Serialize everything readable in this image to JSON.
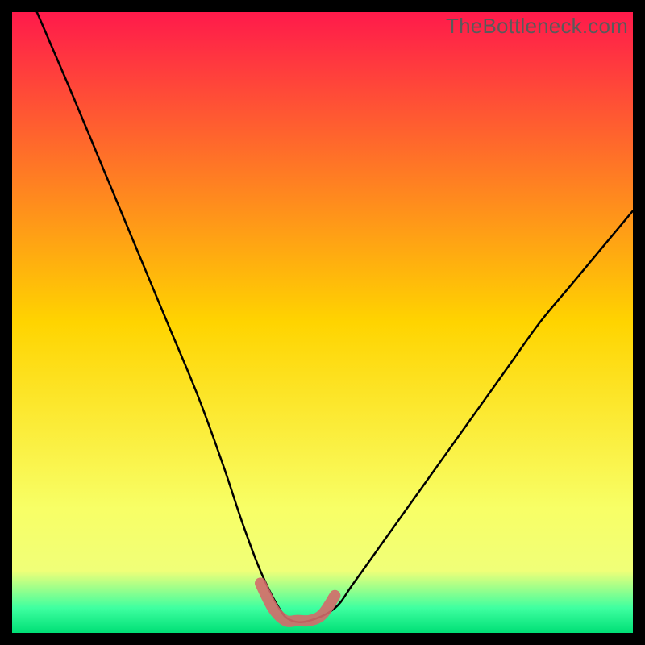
{
  "watermark": "TheBottleneck.com",
  "colors": {
    "frame": "#000000",
    "grad_top": "#ff1a4b",
    "grad_mid": "#ffd400",
    "grad_low": "#f8ff66",
    "grad_band_top": "#f0ff78",
    "grad_band_bottom": "#3effa0",
    "grad_bottom": "#00df76",
    "curve": "#000000",
    "highlight": "#d46a6a"
  },
  "chart_data": {
    "type": "line",
    "title": "",
    "xlabel": "",
    "ylabel": "",
    "xlim": [
      0,
      100
    ],
    "ylim": [
      0,
      100
    ],
    "series": [
      {
        "name": "bottleneck-curve",
        "x": [
          4,
          10,
          15,
          20,
          25,
          30,
          34,
          37,
          40,
          43,
          45,
          48,
          52,
          55,
          60,
          65,
          70,
          75,
          80,
          85,
          90,
          95,
          100
        ],
        "y": [
          100,
          86,
          74,
          62,
          50,
          38,
          27,
          18,
          10,
          4,
          2,
          2,
          4,
          8,
          15,
          22,
          29,
          36,
          43,
          50,
          56,
          62,
          68
        ]
      },
      {
        "name": "highlight-segment",
        "x": [
          40,
          42,
          44,
          46,
          48,
          50,
          52
        ],
        "y": [
          8,
          4,
          2,
          2,
          2,
          3,
          6
        ]
      }
    ],
    "gradient_stops": [
      {
        "pct": 0,
        "color": "#ff1a4b"
      },
      {
        "pct": 50,
        "color": "#ffd400"
      },
      {
        "pct": 80,
        "color": "#f8ff66"
      },
      {
        "pct": 90,
        "color": "#f0ff78"
      },
      {
        "pct": 96,
        "color": "#3effa0"
      },
      {
        "pct": 100,
        "color": "#00df76"
      }
    ]
  }
}
